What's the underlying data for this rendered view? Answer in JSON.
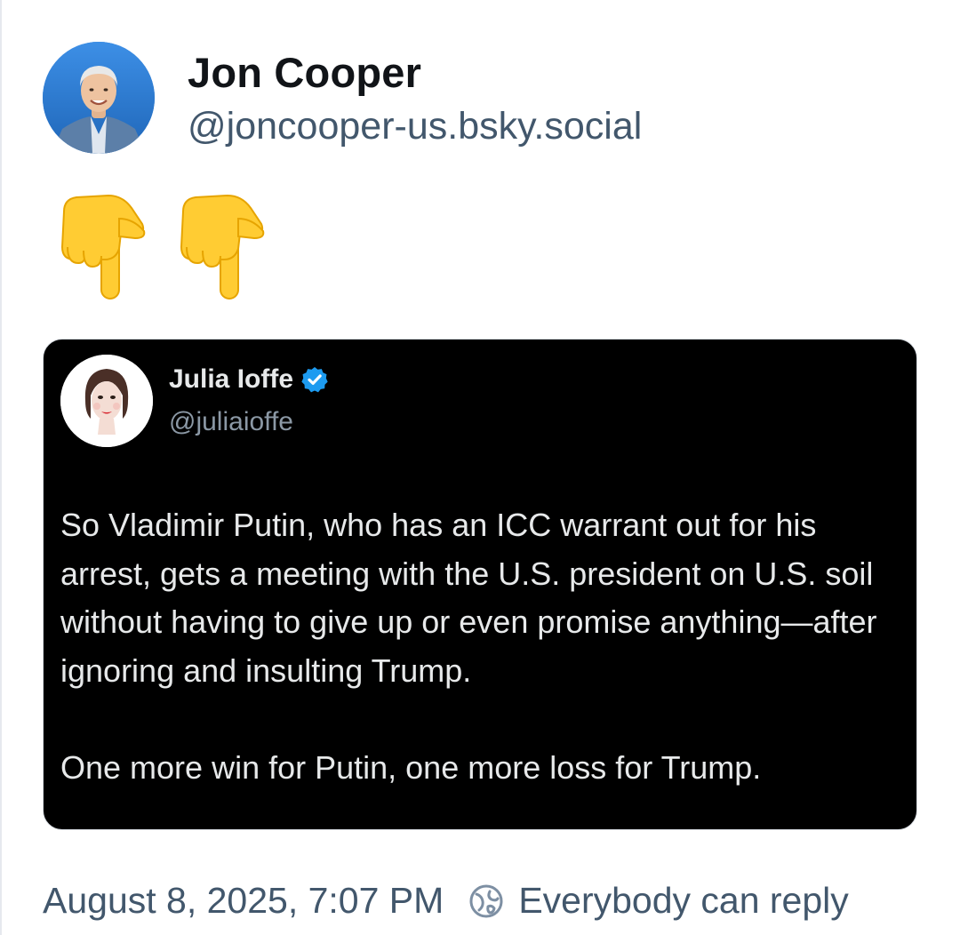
{
  "post": {
    "author": {
      "name": "Jon Cooper",
      "handle": "@joncooper-us.bsky.social"
    },
    "content_emojis": [
      "backhand-index-pointing-down",
      "backhand-index-pointing-down"
    ],
    "embed": {
      "author_name": "Julia Ioffe",
      "author_handle": "@juliaioffe",
      "verified": true,
      "paragraphs": [
        "So Vladimir Putin, who has an ICC warrant out for his arrest, gets a meeting with the U.S. president on U.S. soil without having to give up or even promise anything—after ignoring and insulting Trump.",
        "One more win for Putin, one more loss for Trump."
      ]
    },
    "timestamp": "August 8, 2025, 7:07 PM",
    "reply_setting": "Everybody can reply"
  },
  "colors": {
    "muted_text": "#42576c",
    "embed_background": "#000000",
    "verified_badge": "#1d9bf0",
    "emoji": "#ffcc33"
  }
}
